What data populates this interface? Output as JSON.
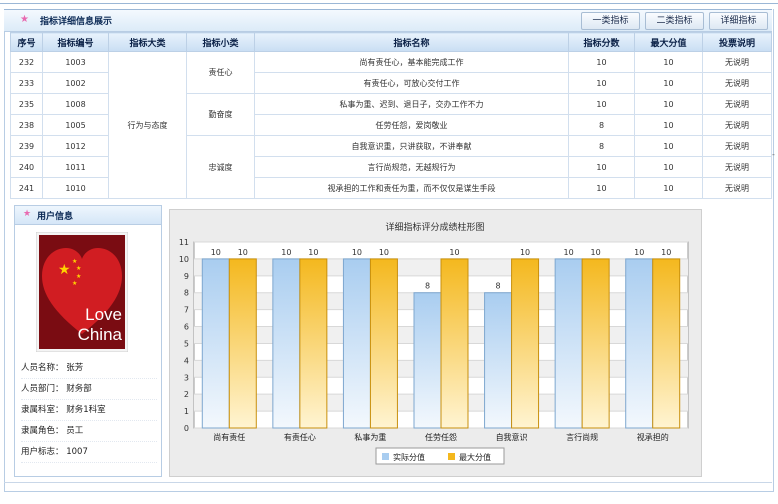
{
  "header": {
    "title": "指标详细信息展示",
    "tabs": [
      "一类指标",
      "二类指标",
      "详细指标"
    ]
  },
  "table": {
    "columns": [
      "序号",
      "指标编号",
      "指标大类",
      "指标小类",
      "指标名称",
      "指标分数",
      "最大分值",
      "投票说明"
    ],
    "category": "行为与态度",
    "subcategories": [
      "责任心",
      "勤奋度",
      "忠诚度"
    ],
    "rows": [
      {
        "seq": "232",
        "code": "1003",
        "name": "尚有责任心，基本能完成工作",
        "score": "10",
        "max": "10",
        "note": "无说明"
      },
      {
        "seq": "233",
        "code": "1002",
        "name": "有责任心，可放心交付工作",
        "score": "10",
        "max": "10",
        "note": "无说明"
      },
      {
        "seq": "235",
        "code": "1008",
        "name": "私事为重、迟到、退日子，交办工作不力",
        "score": "10",
        "max": "10",
        "note": "无说明"
      },
      {
        "seq": "238",
        "code": "1005",
        "name": "任劳任怨，爱岗敬业",
        "score": "8",
        "max": "10",
        "note": "无说明"
      },
      {
        "seq": "239",
        "code": "1012",
        "name": "自我意识重，只讲获取，不讲奉献",
        "score": "8",
        "max": "10",
        "note": "无说明"
      },
      {
        "seq": "240",
        "code": "1011",
        "name": "言行尚规范，无越规行为",
        "score": "10",
        "max": "10",
        "note": "无说明"
      },
      {
        "seq": "241",
        "code": "1010",
        "name": "视承担的工作和责任为重，而不仅仅是谋生手段",
        "score": "10",
        "max": "10",
        "note": "无说明"
      }
    ]
  },
  "user": {
    "panel_title": "用户信息",
    "avatar_text": [
      "Love",
      "China"
    ],
    "fields": [
      {
        "label": "人员名称：",
        "value": "张芳"
      },
      {
        "label": "人员部门：",
        "value": "财务部"
      },
      {
        "label": "隶属科室：",
        "value": "财务1科室"
      },
      {
        "label": "隶属角色：",
        "value": "员工"
      },
      {
        "label": "用户标志：",
        "value": "1007"
      }
    ]
  },
  "side_mark": "-",
  "chart_data": {
    "type": "bar",
    "title": "详细指标评分成绩柱形图",
    "categories": [
      "尚有责任",
      "有责任心",
      "私事为重",
      "任劳任怨",
      "自我意识",
      "言行尚规",
      "视承担的"
    ],
    "series": [
      {
        "name": "实际分值",
        "values": [
          10,
          10,
          10,
          8,
          8,
          10,
          10
        ],
        "color": "#a9cdf0"
      },
      {
        "name": "最大分值",
        "values": [
          10,
          10,
          10,
          10,
          10,
          10,
          10
        ],
        "color": "#f4b81e"
      }
    ],
    "ylim": [
      0,
      11
    ],
    "yticks": [
      0,
      1,
      2,
      3,
      4,
      5,
      6,
      7,
      8,
      9,
      10,
      11
    ],
    "legend": "bottom-center",
    "grid": true
  }
}
